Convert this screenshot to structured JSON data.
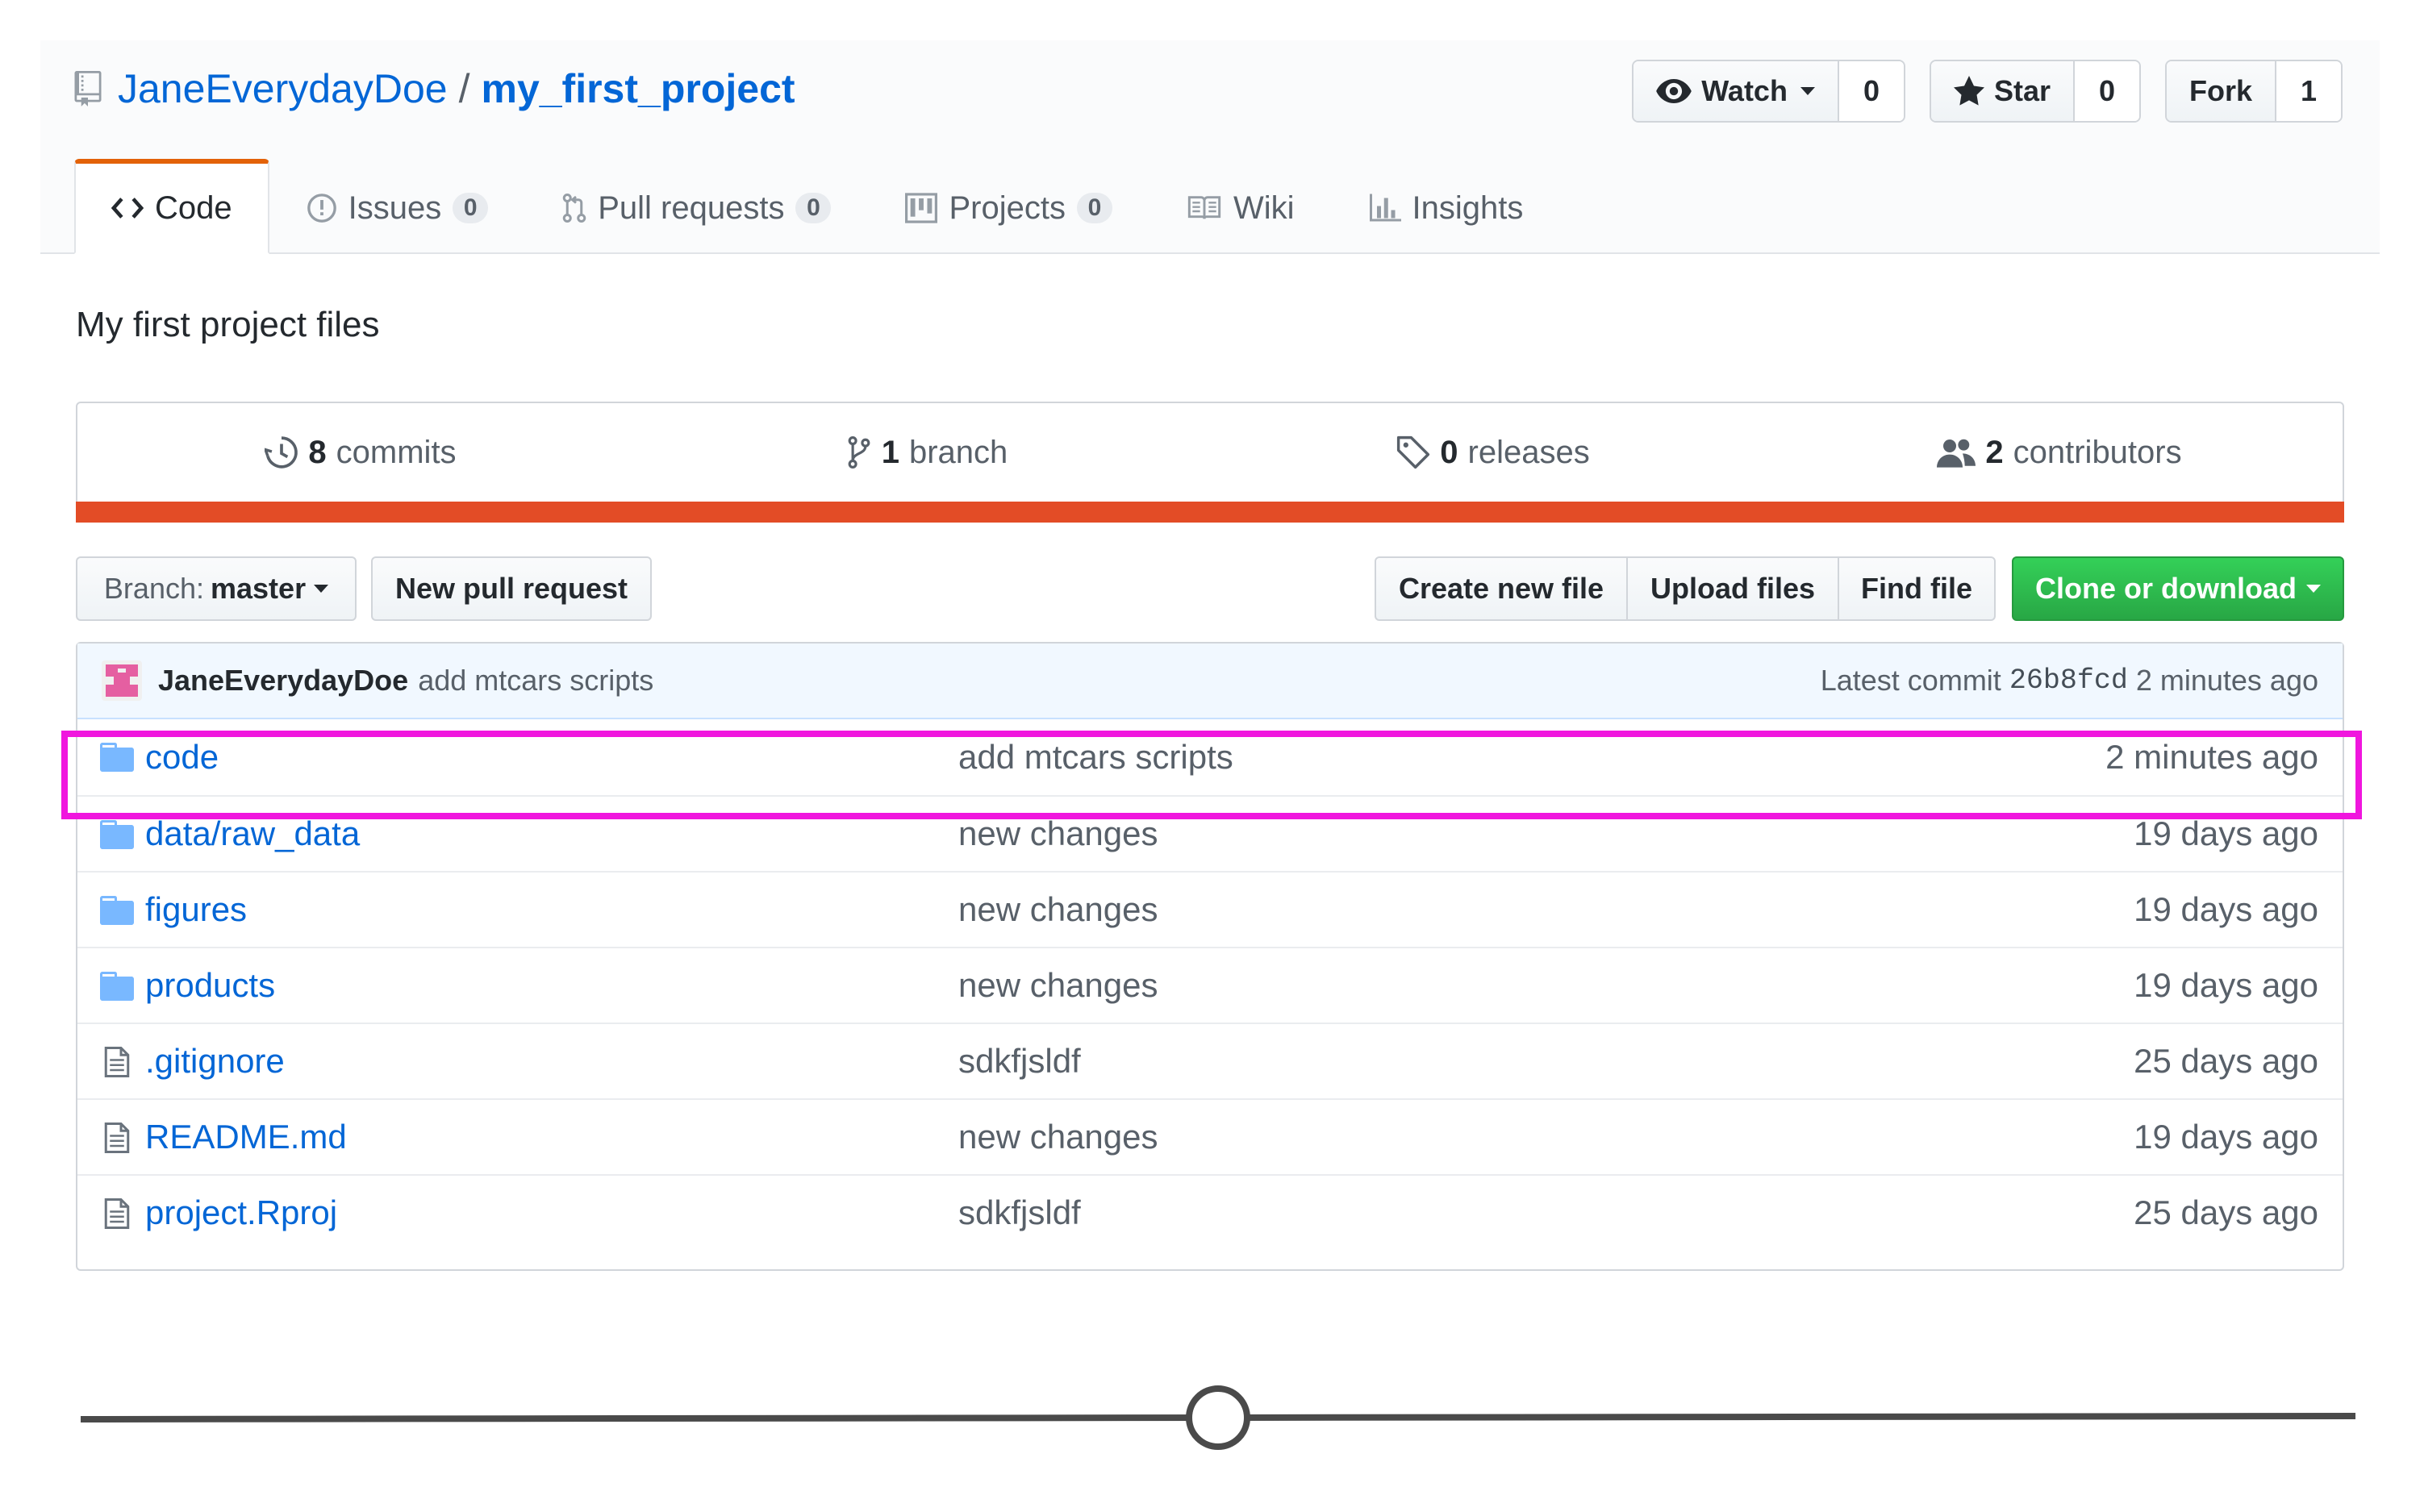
{
  "repo": {
    "owner": "JaneEverydayDoe",
    "separator": "/",
    "name": "my_first_project"
  },
  "actions": {
    "watch": {
      "label": "Watch",
      "count": "0",
      "icon": "eye-icon"
    },
    "star": {
      "label": "Star",
      "count": "0",
      "icon": "star-icon"
    },
    "fork": {
      "label": "Fork",
      "count": "1"
    }
  },
  "tabs": [
    {
      "label": "Code",
      "icon": "code-icon",
      "selected": true
    },
    {
      "label": "Issues",
      "count": "0",
      "icon": "issue-icon"
    },
    {
      "label": "Pull requests",
      "count": "0",
      "icon": "pull-request-icon"
    },
    {
      "label": "Projects",
      "count": "0",
      "icon": "project-icon"
    },
    {
      "label": "Wiki",
      "icon": "book-icon"
    },
    {
      "label": "Insights",
      "icon": "graph-icon"
    }
  ],
  "description": "My first project files",
  "summary": {
    "commits": {
      "count": "8",
      "label": "commits"
    },
    "branches": {
      "count": "1",
      "label": "branch"
    },
    "releases": {
      "count": "0",
      "label": "releases"
    },
    "contributors": {
      "count": "2",
      "label": "contributors"
    },
    "language_color": "#e34c26"
  },
  "filenav": {
    "branch_prefix": "Branch:",
    "branch_name": "master",
    "new_pr": "New pull request",
    "create_file": "Create new file",
    "upload_files": "Upload files",
    "find_file": "Find file",
    "clone": "Clone or download"
  },
  "latest_commit": {
    "author": "JaneEverydayDoe",
    "message": "add mtcars scripts",
    "prefix": "Latest commit",
    "sha": "26b8fcd",
    "age": "2 minutes ago"
  },
  "files": [
    {
      "name": "code",
      "type": "folder",
      "message": "add mtcars scripts",
      "age": "2 minutes ago"
    },
    {
      "name": "data/raw_data",
      "type": "folder",
      "message": "new changes",
      "age": "19 days ago"
    },
    {
      "name": "figures",
      "type": "folder",
      "message": "new changes",
      "age": "19 days ago"
    },
    {
      "name": "products",
      "type": "folder",
      "message": "new changes",
      "age": "19 days ago"
    },
    {
      "name": ".gitignore",
      "type": "file",
      "message": "sdkfjsldf",
      "age": "25 days ago"
    },
    {
      "name": "README.md",
      "type": "file",
      "message": "new changes",
      "age": "19 days ago"
    },
    {
      "name": "project.Rproj",
      "type": "file",
      "message": "sdkfjsldf",
      "age": "25 days ago"
    }
  ],
  "highlight_color": "#f016de",
  "slider": {
    "value": 0.5
  }
}
